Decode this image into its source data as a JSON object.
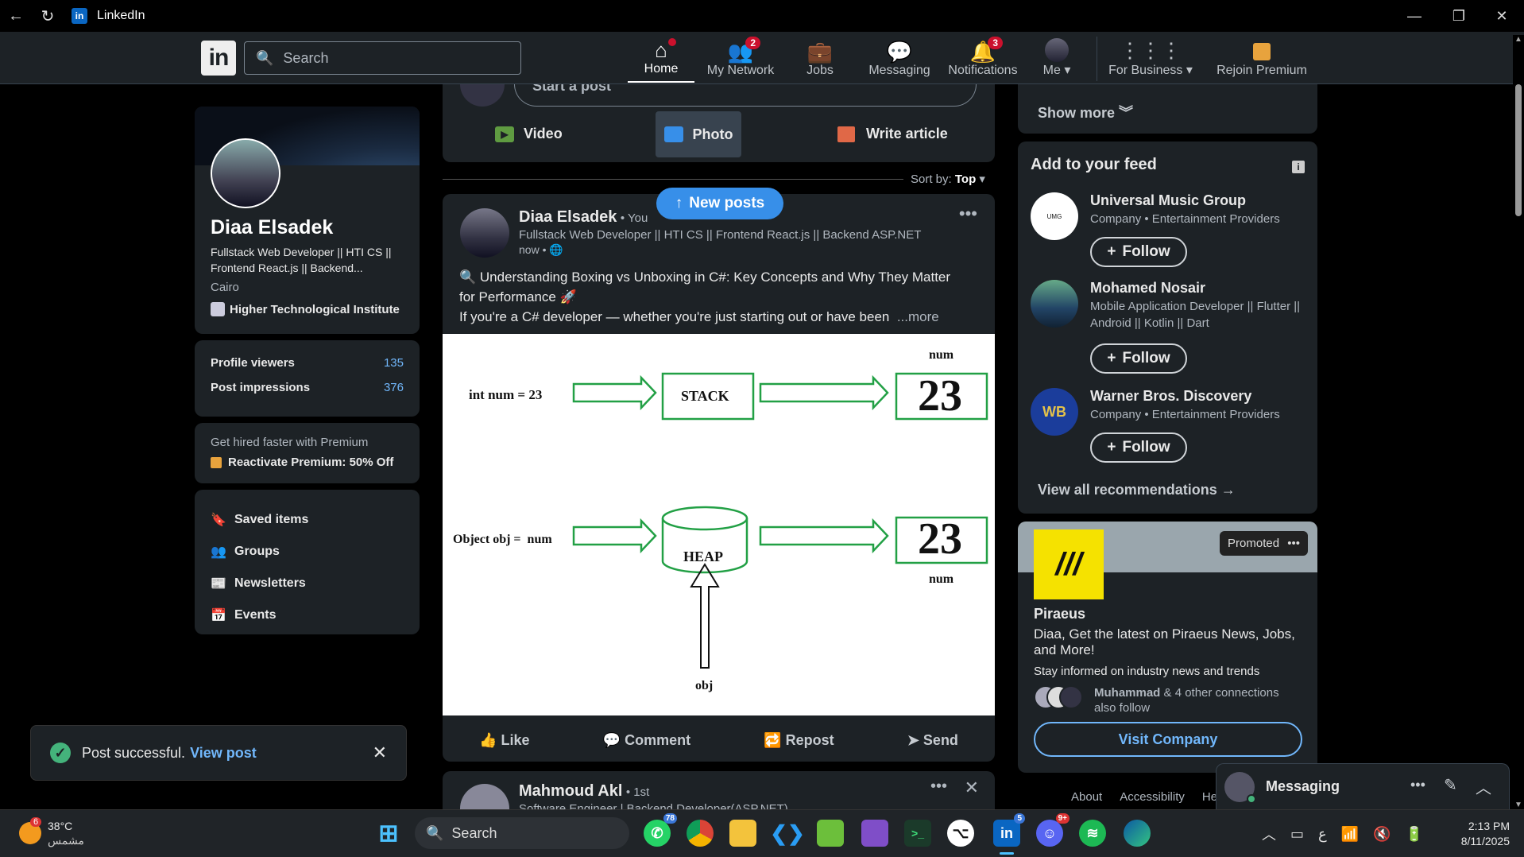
{
  "window": {
    "title": "LinkedIn"
  },
  "nav": {
    "search_placeholder": "Search",
    "items": [
      {
        "label": "Home",
        "badge": ""
      },
      {
        "label": "My Network",
        "badge": "2"
      },
      {
        "label": "Jobs",
        "badge": ""
      },
      {
        "label": "Messaging",
        "badge": ""
      },
      {
        "label": "Notifications",
        "badge": "3"
      },
      {
        "label": "Me",
        "badge": ""
      },
      {
        "label": "For Business",
        "badge": ""
      },
      {
        "label": "Rejoin Premium",
        "badge": ""
      }
    ]
  },
  "profile": {
    "name": "Diaa Elsadek",
    "headline": "Fullstack Web Developer || HTI CS || Frontend React.js || Backend...",
    "location": "Cairo",
    "school": "Higher Technological Institute",
    "stats": [
      {
        "label": "Profile viewers",
        "value": "135"
      },
      {
        "label": "Post impressions",
        "value": "376"
      }
    ],
    "premium_text": "Get hired faster with Premium",
    "premium_link": "Reactivate Premium: 50% Off",
    "links": [
      "Saved items",
      "Groups",
      "Newsletters",
      "Events"
    ]
  },
  "toast": {
    "text": "Post successful.",
    "link": "View post"
  },
  "composer": {
    "placeholder": "Start a post",
    "actions": [
      "Video",
      "Photo",
      "Write article"
    ]
  },
  "sort": {
    "label": "Sort by:",
    "value": "Top"
  },
  "new_posts": "New posts",
  "post": {
    "author": "Diaa Elsadek",
    "you": "• You",
    "headline": "Fullstack Web Developer || HTI CS || Frontend React.js || Backend ASP.NET",
    "time": "now •",
    "line1": "🔍 Understanding Boxing vs Unboxing in C#: Key Concepts and Why They Matter",
    "line2": "for Performance 🚀",
    "line3": "If you're a C# developer — whether you're just starting out or have been",
    "more": "...more",
    "diagram": {
      "left_top": "int num = 23",
      "stack": "STACK",
      "value_top": "23",
      "num_top": "num",
      "left_bottom": "Object obj =  num",
      "heap": "HEAP",
      "value_bottom": "23",
      "num_bottom": "num",
      "obj": "obj"
    },
    "actions": [
      "Like",
      "Comment",
      "Repost",
      "Send"
    ]
  },
  "next_post": {
    "author": "Mahmoud Akl",
    "degree": "• 1st",
    "headline": "Software Engineer | Backend Developer(ASP.NET)"
  },
  "right": {
    "show_more": "Show more",
    "feed_title": "Add to your feed",
    "recommendations": [
      {
        "name": "Universal Music Group",
        "sub": "Company • Entertainment Providers",
        "sub2": "",
        "follow": "Follow"
      },
      {
        "name": "Mohamed Nosair",
        "sub": "Mobile Application Developer || Flutter ||",
        "sub2": "Android || Kotlin || Dart",
        "follow": "Follow"
      },
      {
        "name": "Warner Bros. Discovery",
        "sub": "Company • Entertainment Providers",
        "sub2": "",
        "follow": "Follow"
      }
    ],
    "view_all": "View all recommendations →",
    "ad": {
      "promoted": "Promoted",
      "company": "Piraeus",
      "headline": "Diaa, Get the latest on Piraeus News, Jobs, and More!",
      "sub": "Stay informed on industry news and trends",
      "connections_name": "Muhammad",
      "connections_rest": "& 4 other connections also follow",
      "cta": "Visit Company"
    },
    "footer": [
      "About",
      "Accessibility",
      "Help"
    ]
  },
  "messaging": {
    "label": "Messaging"
  },
  "taskbar": {
    "weather_temp": "38°C",
    "weather_desc": "مشمس",
    "weather_badge": "6",
    "search": "Search",
    "whatsapp_badge": "78",
    "linkedin_badge": "5",
    "discord_badge": "9+",
    "lang": "ع",
    "time": "2:13 PM",
    "date": "8/11/2025"
  }
}
